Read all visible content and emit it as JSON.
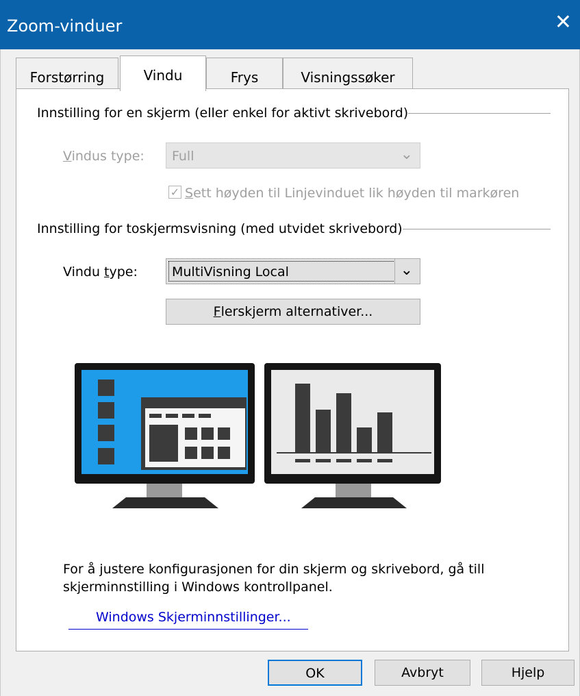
{
  "window": {
    "title": "Zoom-vinduer",
    "close_glyph": "✕"
  },
  "tabs": [
    {
      "label": "Forstørring",
      "active": false
    },
    {
      "label": "Vindu",
      "active": true
    },
    {
      "label": "Frys",
      "active": false
    },
    {
      "label": "Visningssøker",
      "active": false
    }
  ],
  "single_screen": {
    "group_label": "Innstilling for en skjerm (eller enkel for aktivt skrivebord)",
    "window_type_label_first": "V",
    "window_type_label_rest": "indus type:",
    "window_type_value": "Full",
    "checkbox_checked": true,
    "checkbox_label_first": "S",
    "checkbox_label_rest": "ett høyden til Linjevinduet lik høyden til markøren"
  },
  "dual_screen": {
    "group_label": "Innstilling for toskjermsvisning (med utvidet skrivebord)",
    "window_type_label_before": "Vindu ",
    "window_type_label_underlined": "t",
    "window_type_label_after": "ype:",
    "window_type_value": "MultiVisning Local",
    "multi_button_first": "F",
    "multi_button_rest": "lerskjerm alternativer..."
  },
  "info_text_line1": "For å justere konfigurasjonen for din skjerm og skrivebord, gå till",
  "info_text_line2": "skjerminnstilling i Windows kontrollpanel.",
  "link_text": "Windows Skjerminnstillinger...",
  "buttons": {
    "ok": "OK",
    "cancel": "Avbryt",
    "help": "Hjelp"
  },
  "colors": {
    "titlebar": "#0a62aa",
    "monitor_left_screen": "#1e9be9",
    "link": "#0000cc"
  }
}
